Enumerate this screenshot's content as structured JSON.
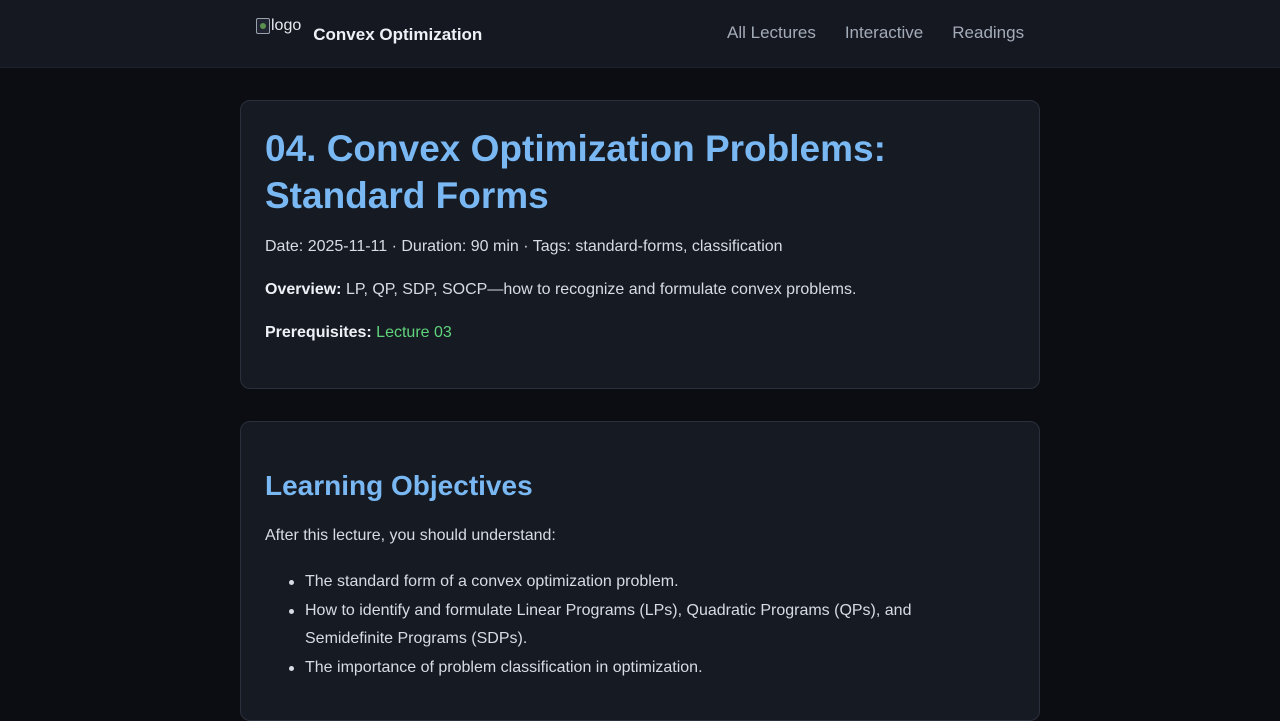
{
  "header": {
    "logo_alt": "logo",
    "brand": "Convex Optimization",
    "nav": [
      {
        "label": "All Lectures"
      },
      {
        "label": "Interactive"
      },
      {
        "label": "Readings"
      }
    ]
  },
  "lecture": {
    "title": "04. Convex Optimization Problems: Standard Forms",
    "meta": "Date: 2025-11-11 · Duration: 90 min · Tags: standard-forms, classification",
    "overview_label": "Overview:",
    "overview_text": "LP, QP, SDP, SOCP—how to recognize and formulate convex problems.",
    "prereq_label": "Prerequisites:",
    "prereq_link": "Lecture 03"
  },
  "objectives": {
    "title": "Learning Objectives",
    "intro": "After this lecture, you should understand:",
    "items": [
      "The standard form of a convex optimization problem.",
      "How to identify and formulate Linear Programs (LPs), Quadratic Programs (QPs), and Semidefinite Programs (SDPs).",
      "The importance of problem classification in optimization."
    ]
  }
}
